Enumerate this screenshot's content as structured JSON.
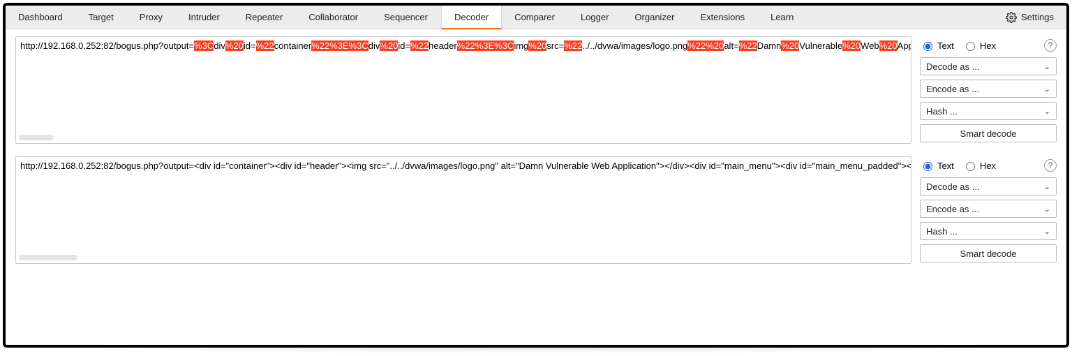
{
  "tabs": [
    "Dashboard",
    "Target",
    "Proxy",
    "Intruder",
    "Repeater",
    "Collaborator",
    "Sequencer",
    "Decoder",
    "Comparer",
    "Logger",
    "Organizer",
    "Extensions",
    "Learn"
  ],
  "active_tab": "Decoder",
  "settings_label": "Settings",
  "panel1": {
    "prefix": "http://192.168.0.252:82/bogus.php?output=",
    "segments": [
      {
        "t": "%3C",
        "h": true
      },
      {
        "t": "div",
        "h": false
      },
      {
        "t": "%20",
        "h": true
      },
      {
        "t": "id=",
        "h": false
      },
      {
        "t": "%22",
        "h": true
      },
      {
        "t": "container",
        "h": false
      },
      {
        "t": "%22%3E%3C",
        "h": true
      },
      {
        "t": "div",
        "h": false
      },
      {
        "t": "%20",
        "h": true
      },
      {
        "t": "id=",
        "h": false
      },
      {
        "t": "%22",
        "h": true
      },
      {
        "t": "header",
        "h": false
      },
      {
        "t": "%22%3E%3C",
        "h": true
      },
      {
        "t": "img",
        "h": false
      },
      {
        "t": "%20",
        "h": true
      },
      {
        "t": "src=",
        "h": false
      },
      {
        "t": "%22",
        "h": true
      },
      {
        "t": "../../dvwa/images/logo.png",
        "h": false
      },
      {
        "t": "%22%20",
        "h": true
      },
      {
        "t": "alt=",
        "h": false
      },
      {
        "t": "%22",
        "h": true
      },
      {
        "t": "Damn",
        "h": false
      },
      {
        "t": "%20",
        "h": true
      },
      {
        "t": "Vulnerable",
        "h": false
      },
      {
        "t": "%20",
        "h": true
      },
      {
        "t": "Web",
        "h": false
      },
      {
        "t": "%20",
        "h": true
      },
      {
        "t": "Application",
        "h": false
      }
    ],
    "radio_text": "Text",
    "radio_hex": "Hex",
    "radio_selected": "text",
    "decode": "Decode as ...",
    "encode": "Encode as ...",
    "hash": "Hash ...",
    "smart": "Smart decode"
  },
  "panel2": {
    "text": "http://192.168.0.252:82/bogus.php?output=<div id=\"container\"><div id=\"header\"><img src=\"../../dvwa/images/logo.png\" alt=\"Damn Vulnerable Web Application\"></div><div id=\"main_menu\"><div id=\"main_menu_padded\"><ul cla",
    "radio_text": "Text",
    "radio_hex": "Hex",
    "radio_selected": "text",
    "decode": "Decode as ...",
    "encode": "Encode as ...",
    "hash": "Hash ...",
    "smart": "Smart decode"
  }
}
